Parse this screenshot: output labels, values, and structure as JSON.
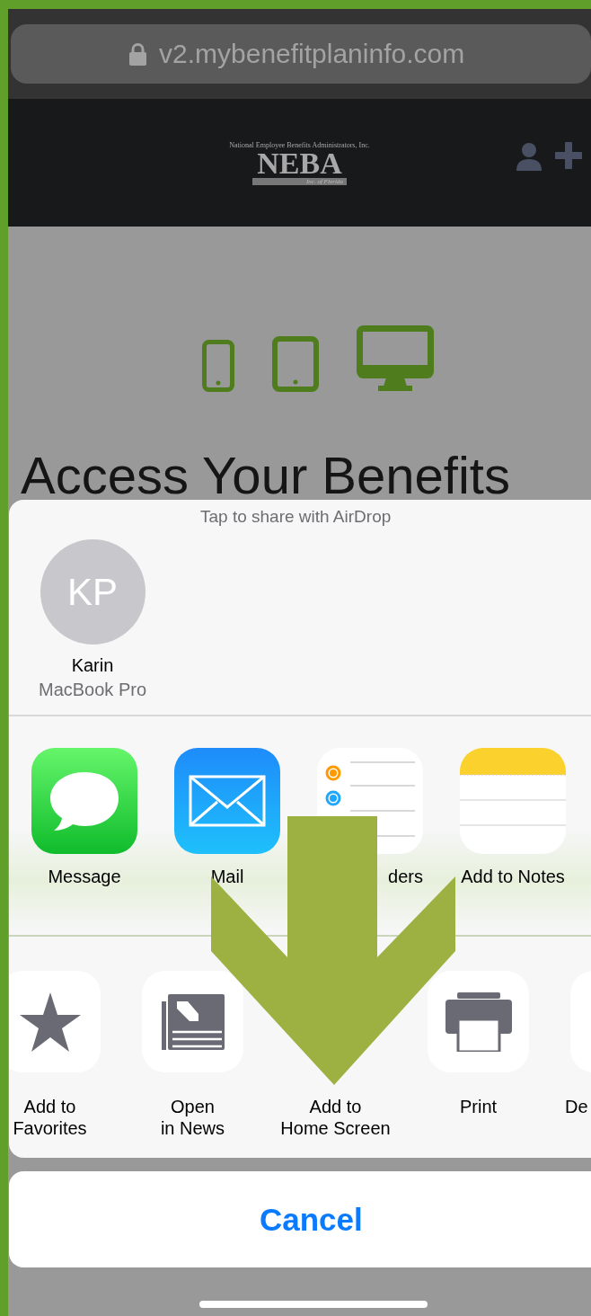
{
  "browser": {
    "url": "v2.mybenefitplaninfo.com"
  },
  "site": {
    "logo": {
      "tagline": "National Employee Benefits Administrators, Inc.",
      "name": "NEBA",
      "subtitle": "Inc. of Florida"
    },
    "heading": "Access Your Benefits"
  },
  "share_sheet": {
    "airdrop_hint": "Tap to share with AirDrop",
    "devices": [
      {
        "initials": "KP",
        "name": "Karin",
        "device": "MacBook Pro"
      }
    ],
    "apps": [
      {
        "kind": "message",
        "label": "Message"
      },
      {
        "kind": "mail",
        "label": "Mail"
      },
      {
        "kind": "reminders",
        "label": "ders"
      },
      {
        "kind": "notes",
        "label": "Add to Notes"
      }
    ],
    "actions": [
      {
        "kind": "favorites",
        "lines": [
          "Add to",
          "Favorites"
        ]
      },
      {
        "kind": "news",
        "lines": [
          "Open",
          "in News"
        ]
      },
      {
        "kind": "home",
        "lines": [
          "Add to",
          "Home Screen"
        ]
      },
      {
        "kind": "print",
        "lines": [
          "Print"
        ]
      },
      {
        "kind": "partial",
        "lines": [
          "De"
        ]
      }
    ],
    "cancel": "Cancel"
  }
}
